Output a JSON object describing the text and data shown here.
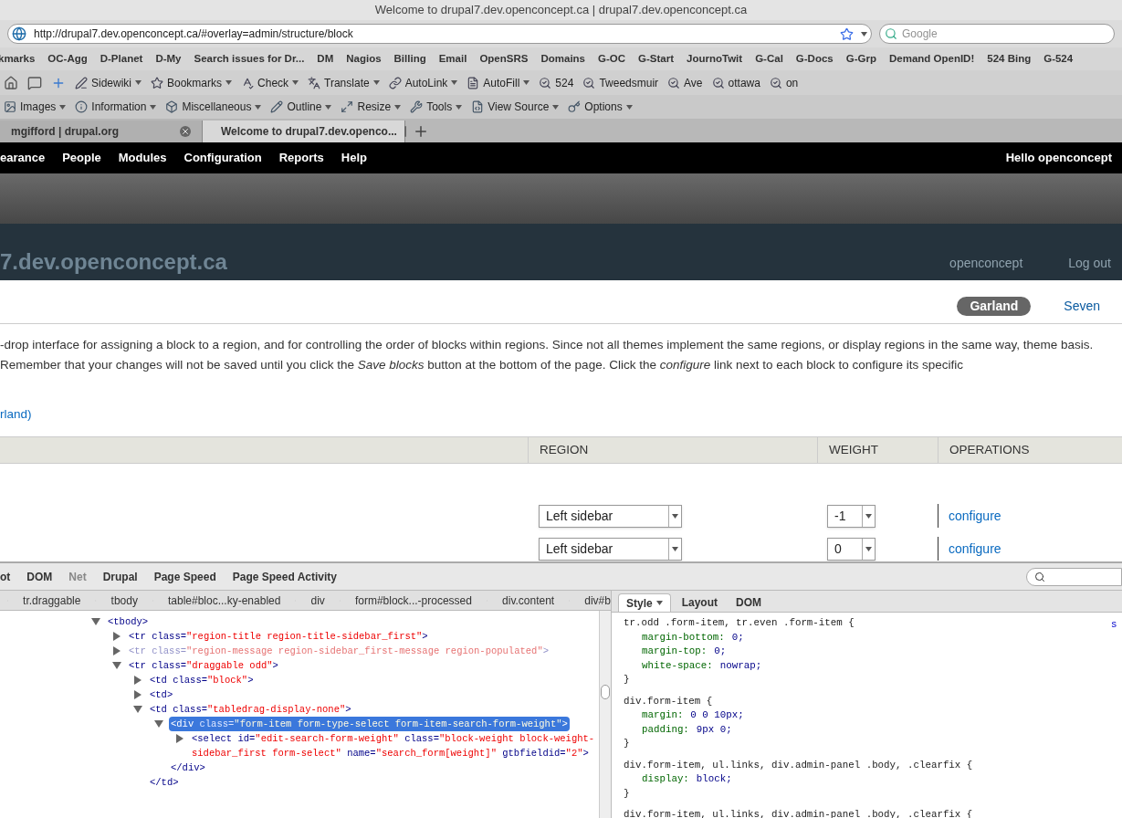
{
  "window": {
    "title": "Welcome to drupal7.dev.openconcept.ca | drupal7.dev.openconcept.ca"
  },
  "address_bar": {
    "url": "http://drupal7.dev.openconcept.ca/#overlay=admin/structure/block",
    "search_placeholder": "Google"
  },
  "bookmarks_bar": [
    "kmarks",
    "OC-Agg",
    "D-Planet",
    "D-My",
    "Search issues for Dr...",
    "DM",
    "Nagios",
    "Billing",
    "Email",
    "OpenSRS",
    "Domains",
    "G-OC",
    "G-Start",
    "JournoTwit",
    "G-Cal",
    "G-Docs",
    "G-Grp",
    "Demand OpenID!",
    "524 Bing",
    "G-524"
  ],
  "toolbar_1": [
    {
      "label": "Sidewiki",
      "dropdown": true
    },
    {
      "label": "Bookmarks",
      "dropdown": true
    },
    {
      "label": "Check",
      "dropdown": true
    },
    {
      "label": "Translate",
      "dropdown": true
    },
    {
      "label": "AutoLink",
      "dropdown": true
    },
    {
      "label": "AutoFill",
      "dropdown": true
    },
    {
      "label": "524",
      "dropdown": false
    },
    {
      "label": "Tweedsmuir",
      "dropdown": false
    },
    {
      "label": "Ave",
      "dropdown": false
    },
    {
      "label": "ottawa",
      "dropdown": false
    },
    {
      "label": "on",
      "dropdown": false
    }
  ],
  "toolbar_2": [
    {
      "label": "Images",
      "dropdown": true
    },
    {
      "label": "Information",
      "dropdown": true
    },
    {
      "label": "Miscellaneous",
      "dropdown": true
    },
    {
      "label": "Outline",
      "dropdown": true
    },
    {
      "label": "Resize",
      "dropdown": true
    },
    {
      "label": "Tools",
      "dropdown": true
    },
    {
      "label": "View Source",
      "dropdown": true
    },
    {
      "label": "Options",
      "dropdown": true
    }
  ],
  "tabs": [
    {
      "label": "mgifford | drupal.org",
      "selected": false
    },
    {
      "label": "Welcome to drupal7.dev.openco...",
      "selected": true
    }
  ],
  "admin_menu": {
    "items": [
      "earance",
      "People",
      "Modules",
      "Configuration",
      "Reports",
      "Help"
    ],
    "greeting": "Hello **openconcept**"
  },
  "site_header": {
    "site_name": "7.dev.openconcept.ca",
    "links": [
      "openconcept",
      "Log out"
    ]
  },
  "overlay": {
    "theme_tabs": [
      {
        "label": "Garland",
        "selected": true
      },
      {
        "label": "Seven",
        "selected": false
      }
    ],
    "description": "-drop interface for assigning a block to a region, and for controlling the order of blocks within regions. Since not all themes implement the same regions, or display regions in the same way, theme basis. Remember that your changes will not be saved until you click the *Save blocks* button at the bottom of the page. Click the *configure* link next to each block to configure its specific",
    "link": "rland)",
    "table": {
      "columns": [
        "REGION",
        "WEIGHT",
        "OPERATIONS"
      ],
      "rows": [
        {
          "region": "Left sidebar",
          "weight": "-1",
          "operation": "configure"
        },
        {
          "region": "Left sidebar",
          "weight": "0",
          "operation": "configure"
        }
      ]
    }
  },
  "firebug": {
    "panels": [
      {
        "label": "ot",
        "disabled": false
      },
      {
        "label": "DOM",
        "disabled": false
      },
      {
        "label": "Net",
        "disabled": true
      },
      {
        "label": "Drupal",
        "disabled": false
      },
      {
        "label": "Page Speed",
        "disabled": false
      },
      {
        "label": "Page Speed Activity",
        "disabled": false
      }
    ],
    "breadcrumbs": [
      "tr.draggable",
      "tbody",
      "table#bloc...ky-enabled",
      "div",
      "form#block...-processed",
      "div.content",
      "div#b"
    ],
    "html_tree": [
      {
        "expanded": true,
        "selected": false,
        "dimmed": false,
        "parts": [
          {
            "kind": "tag",
            "text": "<tbody>"
          }
        ],
        "children": [
          {
            "expanded": false,
            "selected": false,
            "dimmed": false,
            "parts": [
              {
                "kind": "tag",
                "text": "<tr"
              },
              {
                "kind": "attr",
                "text": " class="
              },
              {
                "kind": "value",
                "text": "\"region-title region-title-sidebar_first\""
              },
              {
                "kind": "tag",
                "text": ">"
              }
            ]
          },
          {
            "expanded": false,
            "selected": false,
            "dimmed": true,
            "parts": [
              {
                "kind": "tag",
                "text": "<tr"
              },
              {
                "kind": "attr",
                "text": " class="
              },
              {
                "kind": "value",
                "text": "\"region-message region-sidebar_first-message region-populated\""
              },
              {
                "kind": "tag",
                "text": ">"
              }
            ]
          },
          {
            "expanded": true,
            "selected": false,
            "dimmed": false,
            "parts": [
              {
                "kind": "tag",
                "text": "<tr"
              },
              {
                "kind": "attr",
                "text": " class="
              },
              {
                "kind": "value",
                "text": "\"draggable odd\""
              },
              {
                "kind": "tag",
                "text": ">"
              }
            ],
            "children": [
              {
                "expanded": false,
                "selected": false,
                "dimmed": false,
                "parts": [
                  {
                    "kind": "tag",
                    "text": "<td"
                  },
                  {
                    "kind": "attr",
                    "text": " class="
                  },
                  {
                    "kind": "value",
                    "text": "\"block\""
                  },
                  {
                    "kind": "tag",
                    "text": ">"
                  }
                ]
              },
              {
                "expanded": false,
                "selected": false,
                "dimmed": false,
                "parts": [
                  {
                    "kind": "tag",
                    "text": "<td>"
                  }
                ]
              },
              {
                "expanded": true,
                "selected": false,
                "dimmed": false,
                "parts": [
                  {
                    "kind": "tag",
                    "text": "<td"
                  },
                  {
                    "kind": "attr",
                    "text": " class="
                  },
                  {
                    "kind": "value",
                    "text": "\"tabledrag-display-none\""
                  },
                  {
                    "kind": "tag",
                    "text": ">"
                  }
                ],
                "close": "</td>",
                "children": [
                  {
                    "expanded": true,
                    "selected": true,
                    "dimmed": false,
                    "parts": [
                      {
                        "kind": "tag",
                        "text": "<div"
                      },
                      {
                        "kind": "attr",
                        "text": " class="
                      },
                      {
                        "kind": "value",
                        "text": "\"form-item form-type-select form-item-search-form-weight\""
                      },
                      {
                        "kind": "tag",
                        "text": ">"
                      }
                    ],
                    "close": "</div>",
                    "children": [
                      {
                        "expanded": false,
                        "selected": false,
                        "dimmed": false,
                        "parts": [
                          {
                            "kind": "tag",
                            "text": "<select"
                          },
                          {
                            "kind": "attr",
                            "text": " id="
                          },
                          {
                            "kind": "value",
                            "text": "\"edit-search-form-weight\""
                          },
                          {
                            "kind": "attr",
                            "text": " class="
                          },
                          {
                            "kind": "value",
                            "text": "\"block-weight block-weight-sidebar_first form-select\""
                          },
                          {
                            "kind": "attr",
                            "text": " name="
                          },
                          {
                            "kind": "value",
                            "text": "\"search_form[weight]\""
                          },
                          {
                            "kind": "attr",
                            "text": " gtbfieldid="
                          },
                          {
                            "kind": "value",
                            "text": "\"2\""
                          },
                          {
                            "kind": "tag",
                            "text": ">"
                          }
                        ]
                      }
                    ]
                  }
                ]
              }
            ]
          }
        ]
      }
    ],
    "side_tabs": [
      {
        "label": "Style",
        "selected": true,
        "dropdown": true
      },
      {
        "label": "Layout",
        "selected": false,
        "dropdown": false
      },
      {
        "label": "DOM",
        "selected": false,
        "dropdown": false
      }
    ],
    "source_link": "s",
    "css_rules": [
      {
        "selector": "tr.odd .form-item, tr.even .form-item {",
        "declarations": [
          {
            "property": "margin-bottom:",
            "value": "0;"
          },
          {
            "property": "margin-top:",
            "value": "0;"
          },
          {
            "property": "white-space:",
            "value": "nowrap;"
          }
        ],
        "close": "}"
      },
      {
        "selector": "div.form-item {",
        "declarations": [
          {
            "property": "margin:",
            "value": "0 0 10px;"
          },
          {
            "property": "padding:",
            "value": "9px 0;"
          }
        ],
        "close": "}"
      },
      {
        "selector": "div.form-item, ul.links, div.admin-panel .body, .clearfix {",
        "declarations": [
          {
            "property": "display:",
            "value": "block;"
          }
        ],
        "close": "}"
      },
      {
        "selector": "div.form-item, ul.links, div.admin-panel .body, .clearfix {"
      }
    ]
  }
}
